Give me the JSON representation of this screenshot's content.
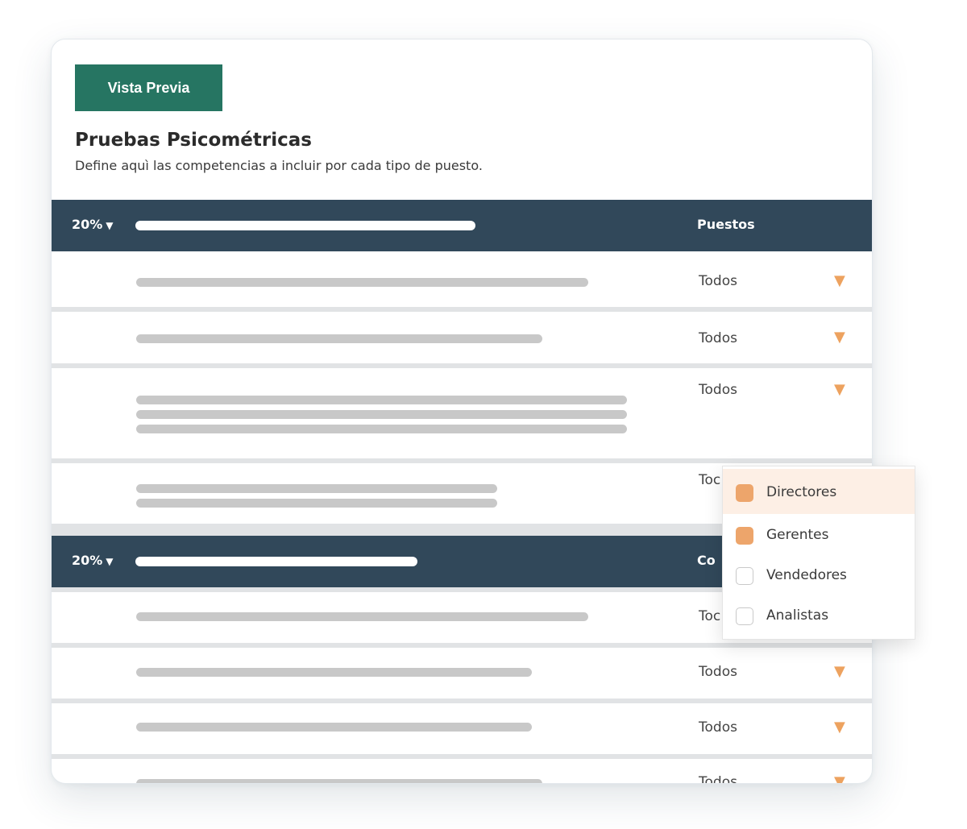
{
  "preview_button": "Vista Previa",
  "title": "Pruebas Psicométricas",
  "subtitle": "Define aquì las competencias a incluir por cada tipo de puesto.",
  "groups": [
    {
      "percent": "20%",
      "column_label": "Puestos"
    },
    {
      "percent": "20%",
      "column_label": "Co"
    }
  ],
  "row_value": "Todos",
  "row_value_partial": "Toc",
  "dropdown": {
    "options": [
      {
        "label": "Directores",
        "checked": true
      },
      {
        "label": "Gerentes",
        "checked": true
      },
      {
        "label": "Vendedores",
        "checked": false
      },
      {
        "label": "Analistas",
        "checked": false
      }
    ]
  },
  "colors": {
    "header_bg": "#31485a",
    "button_bg": "#267562",
    "accent": "#eda25f"
  }
}
